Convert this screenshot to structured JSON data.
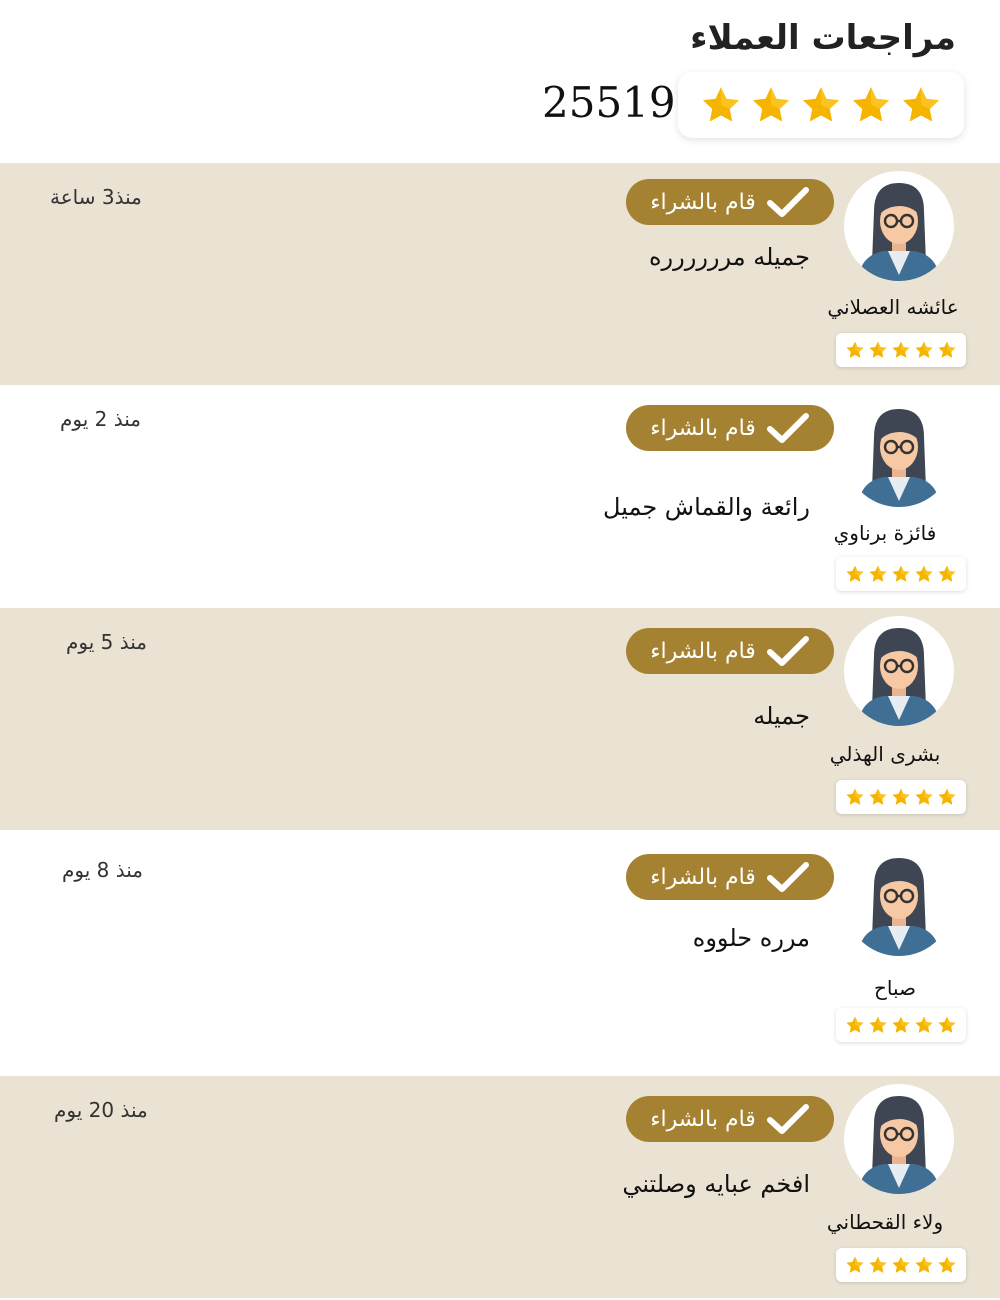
{
  "header": {
    "title": "مراجعات العملاء",
    "total_reviews": "25519",
    "rating_stars": 5
  },
  "badge": {
    "label": "قام بالشراء",
    "icon": "check-icon"
  },
  "colors": {
    "shaded_row": "#eae3d3",
    "badge": "#a58132",
    "star": "#f5b400"
  },
  "reviews": [
    {
      "name": "عائشه العصلاني",
      "text": "جميله مرررررره",
      "time": "منذ3 ساعة",
      "stars": 5
    },
    {
      "name": "فائزة برناوي",
      "text": "رائعة والقماش جميل",
      "time": "منذ 2 يوم",
      "stars": 5
    },
    {
      "name": "بشرى الهذلي",
      "text": "جميله",
      "time": "منذ 5 يوم",
      "stars": 5
    },
    {
      "name": "صباح",
      "text": "مرره حلووه",
      "time": "منذ 8 يوم",
      "stars": 5
    },
    {
      "name": "ولاء القحطاني",
      "text": "افخم عبايه وصلتني",
      "time": "منذ 20 يوم",
      "stars": 5
    }
  ]
}
